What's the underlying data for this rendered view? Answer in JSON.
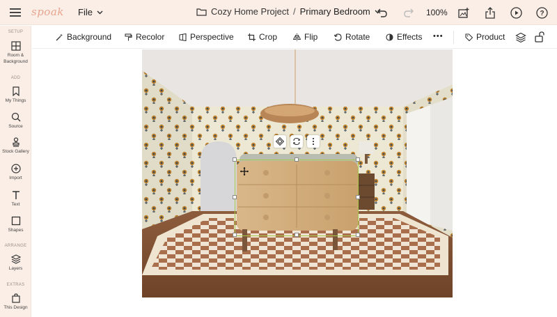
{
  "app": {
    "logo_text": "spoak",
    "file_label": "File",
    "project_name": "Cozy Home Project",
    "separator": "/",
    "room_name": "Primary Bedroom",
    "zoom": "100%"
  },
  "sidebar": {
    "sections": {
      "setup": "SETUP",
      "add": "ADD",
      "arrange": "ARRANGE",
      "extras": "EXTRAS"
    },
    "items": [
      {
        "label": "Room & Background",
        "icon": "grid-icon"
      },
      {
        "label": "My Things",
        "icon": "bookmark-icon"
      },
      {
        "label": "Source",
        "icon": "search-icon"
      },
      {
        "label": "Stock Gallery",
        "icon": "stamp-icon"
      },
      {
        "label": "Import",
        "icon": "plus-circle-icon"
      },
      {
        "label": "Text",
        "icon": "text-icon"
      },
      {
        "label": "Shapes",
        "icon": "square-icon"
      },
      {
        "label": "Layers",
        "icon": "layers-icon"
      },
      {
        "label": "This Design",
        "icon": "bag-icon"
      }
    ]
  },
  "toolbar": {
    "background": "Background",
    "recolor": "Recolor",
    "perspective": "Perspective",
    "crop": "Crop",
    "flip": "Flip",
    "rotate": "Rotate",
    "effects": "Effects",
    "more": "•••",
    "product": "Product"
  },
  "colors": {
    "topbar_bg": "#fbeee6",
    "accent": "#e8a48e",
    "selection": "#a8c94a"
  }
}
